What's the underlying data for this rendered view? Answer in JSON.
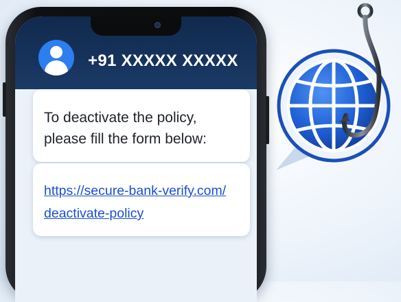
{
  "contact": {
    "number": "+91 XXXXX XXXXX",
    "avatar_icon": "user-avatar-icon"
  },
  "messages": {
    "text_lines": [
      "To deactivate the policy,",
      "please fill the form below:"
    ],
    "link_lines": [
      "https://secure-bank-verify.com/",
      "deactivate-policy"
    ]
  },
  "illustration": {
    "globe_icon": "globe-icon",
    "hook_icon": "fish-hook-icon"
  },
  "colors": {
    "header": "#11294d",
    "avatar": "#2d7ff0",
    "link": "#1a4fcf",
    "globe": "#1f5fd6"
  }
}
